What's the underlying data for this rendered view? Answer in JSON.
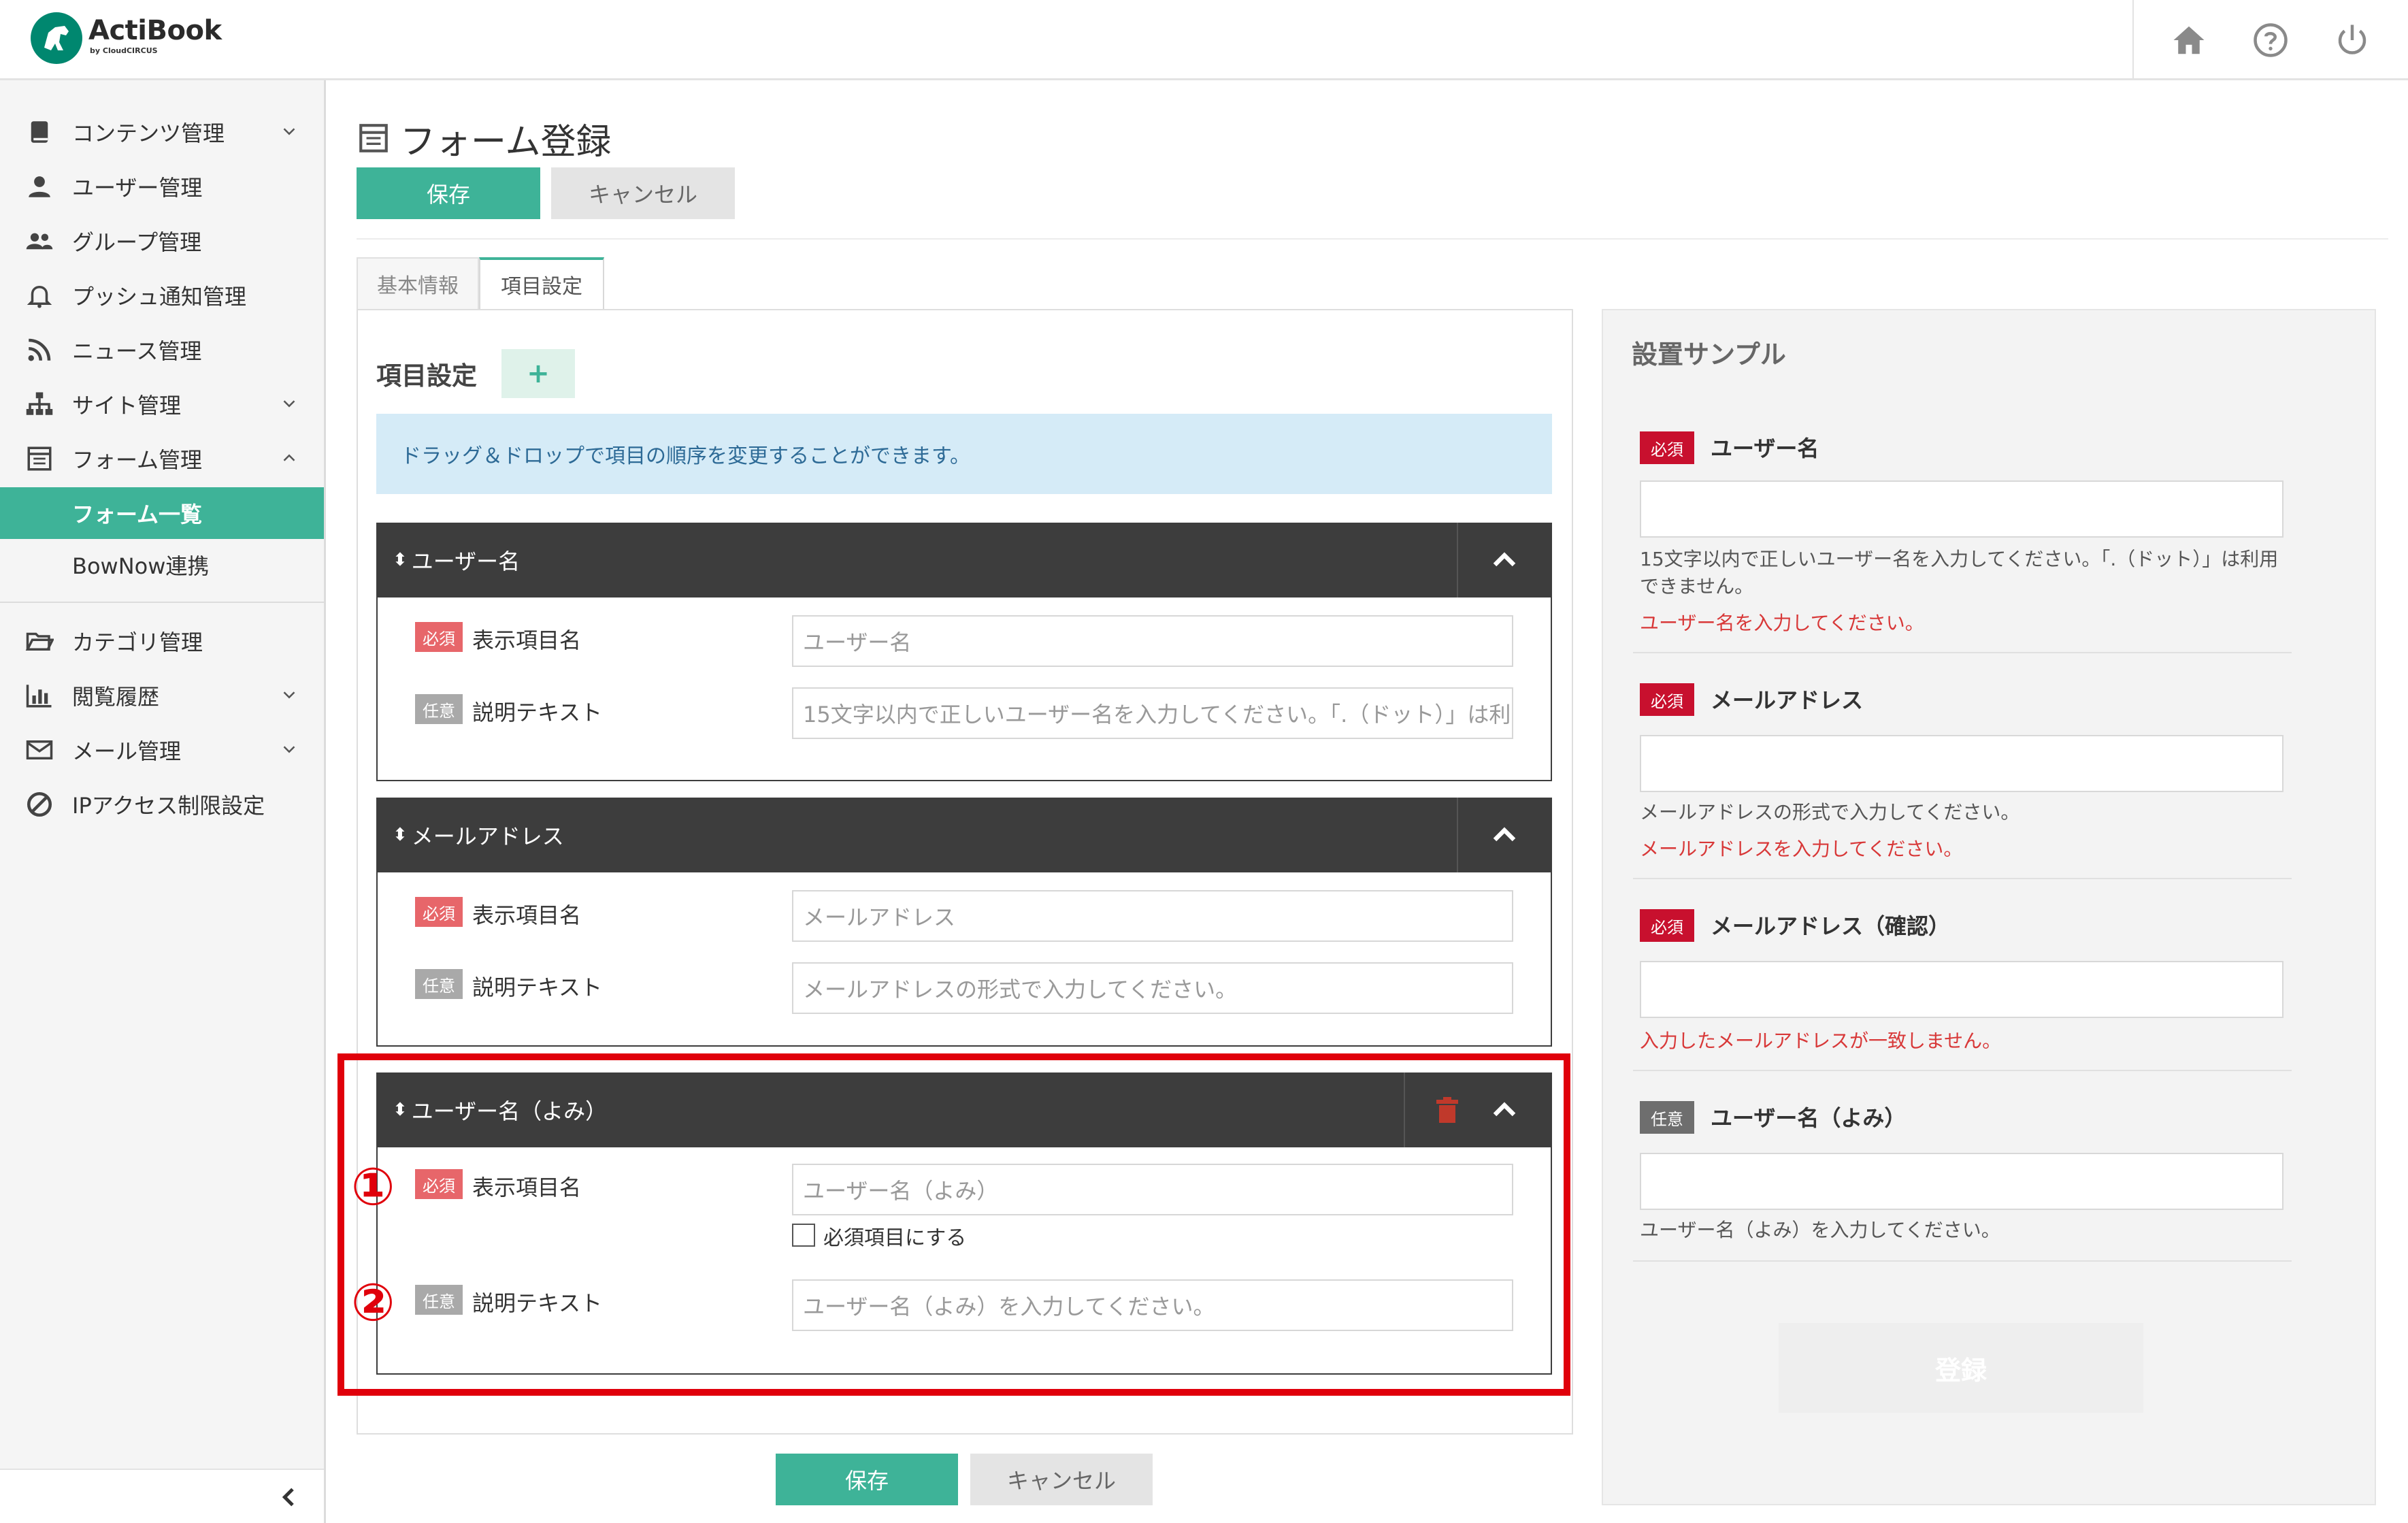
{
  "header": {
    "logo_text": "ActiBook",
    "logo_sub": "by CloudCIRCUS",
    "icons": [
      "home-icon",
      "help-icon",
      "power-icon"
    ]
  },
  "sidebar": {
    "items": [
      {
        "label": "コンテンツ管理",
        "icon": "book-icon",
        "expandable": true
      },
      {
        "label": "ユーザー管理",
        "icon": "user-icon",
        "expandable": false
      },
      {
        "label": "グループ管理",
        "icon": "group-icon",
        "expandable": false
      },
      {
        "label": "プッシュ通知管理",
        "icon": "bell-icon",
        "expandable": false
      },
      {
        "label": "ニュース管理",
        "icon": "rss-icon",
        "expandable": false
      },
      {
        "label": "サイト管理",
        "icon": "sitemap-icon",
        "expandable": true
      },
      {
        "label": "フォーム管理",
        "icon": "form-icon",
        "expandable": true,
        "expanded": true
      }
    ],
    "sub_items": [
      {
        "label": "フォーム一覧",
        "active": true
      },
      {
        "label": "BowNow連携",
        "active": false
      }
    ],
    "items2": [
      {
        "label": "カテゴリ管理",
        "icon": "folder-icon",
        "expandable": false
      },
      {
        "label": "閲覧履歴",
        "icon": "bar-chart-icon",
        "expandable": true
      },
      {
        "label": "メール管理",
        "icon": "mail-icon",
        "expandable": true
      },
      {
        "label": "IPアクセス制限設定",
        "icon": "ban-icon",
        "expandable": false
      }
    ]
  },
  "main": {
    "title": "フォーム登録",
    "save_label": "保存",
    "cancel_label": "キャンセル",
    "tabs": [
      {
        "label": "基本情報",
        "active": false
      },
      {
        "label": "項目設定",
        "active": true
      }
    ],
    "section_title": "項目設定",
    "add_label": "+",
    "info_text": "ドラッグ＆ドロップで項目の順序を変更することができます。",
    "badge_required": "必須",
    "badge_optional": "任意",
    "display_name_label": "表示項目名",
    "description_label": "説明テキスト",
    "items": [
      {
        "name": "ユーザー名",
        "display_value": "ユーザー名",
        "description_value": "15文字以内で正しいユーザー名を入力してください。「.（ドット）」は利"
      },
      {
        "name": "メールアドレス",
        "display_value": "メールアドレス",
        "description_value": "メールアドレスの形式で入力してください。"
      },
      {
        "name": "ユーザー名（よみ）",
        "display_value": "ユーザー名（よみ）",
        "required_checkbox_label": "必須項目にする",
        "required_checked": false,
        "description_value": "ユーザー名（よみ）を入力してください。"
      }
    ],
    "annotation_numbers": [
      "①",
      "②"
    ],
    "highlight_color": "#e0000b"
  },
  "sample": {
    "title": "設置サンプル",
    "fields": [
      {
        "badge": "必須",
        "label": "ユーザー名",
        "help": "15文字以内で正しいユーザー名を入力してください。「.（ドット）」は利用できません。",
        "error": "ユーザー名を入力してください。"
      },
      {
        "badge": "必須",
        "label": "メールアドレス",
        "help": "メールアドレスの形式で入力してください。",
        "error": "メールアドレスを入力してください。"
      },
      {
        "badge": "必須",
        "label": "メールアドレス（確認）",
        "help": "",
        "error": "入力したメールアドレスが一致しません。"
      },
      {
        "badge": "任意",
        "label": "ユーザー名（よみ）",
        "help": "ユーザー名（よみ）を入力してください。",
        "error": ""
      }
    ],
    "submit_label": "登録"
  },
  "colors": {
    "accent": "#3eb398",
    "header_dark": "#3d3d3d",
    "required_badge": "#e7666a",
    "sample_required_badge": "#c8102e",
    "error_text": "#d83838",
    "info_bg": "#d5ebf7"
  }
}
